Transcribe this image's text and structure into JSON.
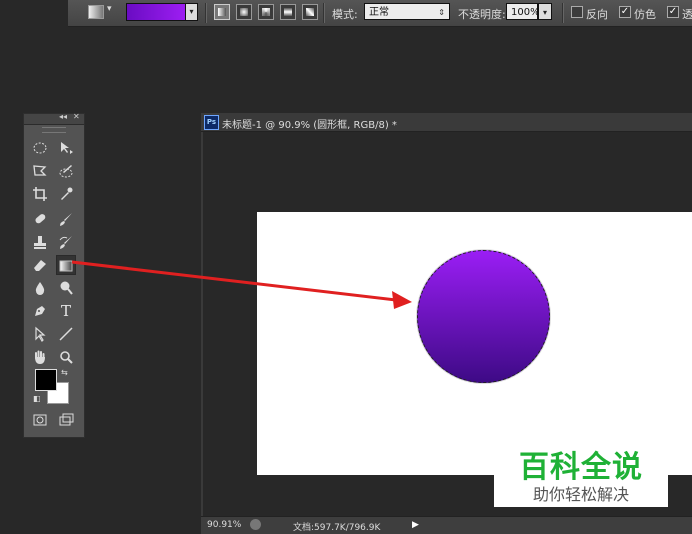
{
  "options_bar": {
    "mode_label": "模式:",
    "mode_value": "正常",
    "opacity_label": "不透明度:",
    "opacity_value": "100%",
    "reverse_label": "反向",
    "dither_label": "仿色",
    "transparency_label": "透",
    "reverse_checked": false,
    "dither_checked": true,
    "transparency_checked": true,
    "gradient_colors": [
      "#6a0cc3",
      "#9d1ef2"
    ],
    "gradient_types": [
      "linear",
      "radial",
      "angle",
      "reflected",
      "diamond"
    ],
    "selected_gradient_type": "linear"
  },
  "tools_panel": {
    "tools": [
      "elliptical-marquee",
      "move",
      "polygonal-lasso",
      "quick-selection",
      "crop",
      "eyedropper",
      "spot-healing-brush",
      "brush",
      "clone-stamp",
      "history-brush",
      "eraser",
      "gradient",
      "blur",
      "dodge",
      "pen",
      "type",
      "path-selection",
      "line",
      "hand",
      "zoom"
    ],
    "active_tool": "gradient",
    "foreground_color": "#000000",
    "background_color": "#ffffff",
    "type_tool_glyph": "T"
  },
  "document": {
    "ps_badge": "Ps",
    "title": "未标题-1 @ 90.9% (圆形框, RGB/8) *",
    "zoom": "90.91%",
    "doc_size": "文档:597.7K/796.9K",
    "circle_gradient": [
      "#9b1ef5",
      "#3d0a85"
    ]
  },
  "annotation": {
    "arrow_color": "#e02020"
  },
  "watermark": {
    "title": "百科全说",
    "subtitle": "助你轻松解决",
    "color": "#1fb136"
  }
}
